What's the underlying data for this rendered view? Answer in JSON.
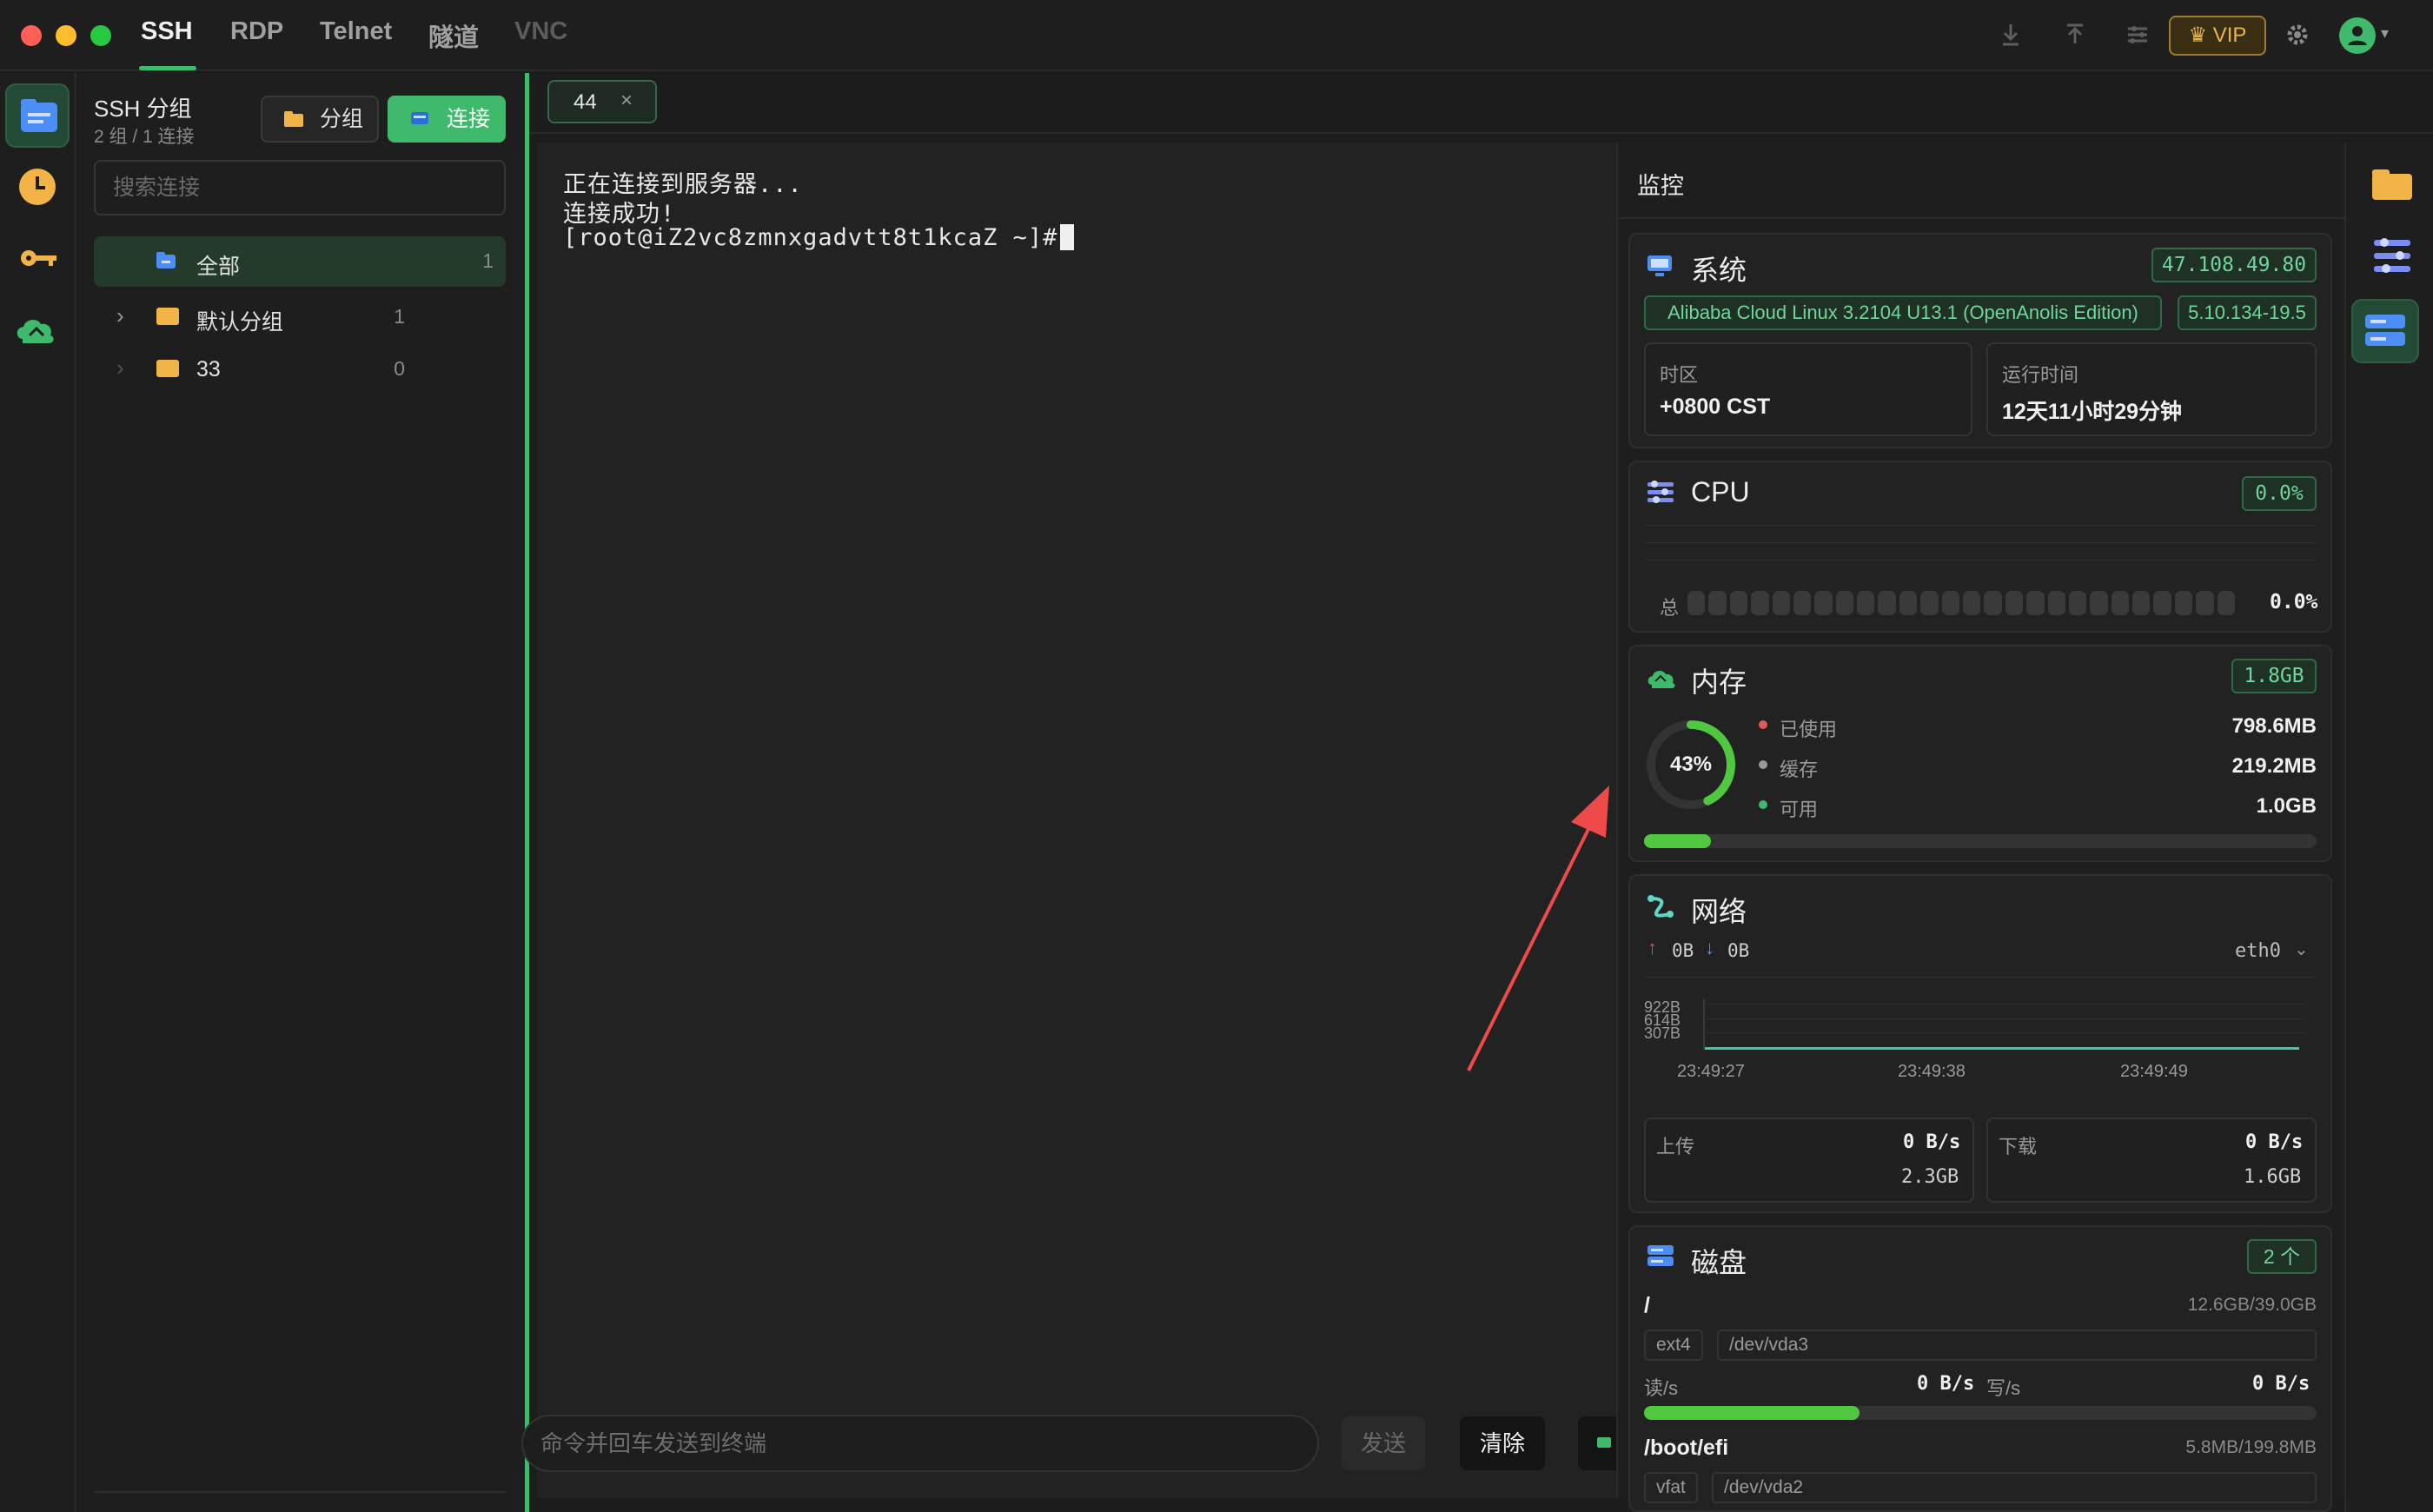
{
  "nav": {
    "tabs": [
      "SSH",
      "RDP",
      "Telnet",
      "隧道",
      "VNC"
    ],
    "vip_label": "VIP"
  },
  "left_panel": {
    "title": "SSH 分组",
    "subtitle": "2 组 / 1 连接",
    "group_button": "分组",
    "connect_button": "连接",
    "search_placeholder": "搜索连接",
    "tree": [
      {
        "label": "全部",
        "count": "1"
      },
      {
        "label": "默认分组",
        "count": "1"
      },
      {
        "label": "33",
        "count": "0"
      }
    ]
  },
  "session_tab": {
    "label": "44",
    "close": "×"
  },
  "terminal": {
    "lines": [
      "正在连接到服务器...",
      "连接成功!",
      "[root@iZ2vc8zmnxgadvtt8t1kcaZ ~]# "
    ],
    "input_placeholder": "命令并回车发送到终端",
    "send": "发送",
    "clear": "清除"
  },
  "monitor": {
    "title": "监控",
    "system": {
      "title": "系统",
      "ip": "47.108.49.80",
      "os": "Alibaba Cloud Linux 3.2104 U13.1 (OpenAnolis Edition)",
      "kernel": "5.10.134-19.5",
      "timezone_label": "时区",
      "timezone": "+0800 CST",
      "uptime_label": "运行时间",
      "uptime": "12天11小时29分钟"
    },
    "cpu": {
      "title": "CPU",
      "badge": "0.0%",
      "total_label": "总",
      "total_value": "0.0%",
      "segments": 26
    },
    "memory": {
      "title": "内存",
      "badge": "1.8GB",
      "percent_label": "43%",
      "percent": 43,
      "used_label": "已使用",
      "used": "798.6MB",
      "cache_label": "缓存",
      "cache": "219.2MB",
      "free_label": "可用",
      "free": "1.0GB",
      "bar_fraction": 0.1,
      "colors": {
        "used": "#e05a5a",
        "cache": "#9a9a9a",
        "free": "#3fb96b"
      }
    },
    "network": {
      "title": "网络",
      "up": "0B",
      "down": "0B",
      "interface": "eth0",
      "y_ticks": [
        "922B",
        "614B",
        "307B"
      ],
      "x_ticks": [
        "23:49:27",
        "23:49:38",
        "23:49:49"
      ],
      "upload_label": "上传",
      "upload_rate": "0 B/s",
      "upload_total": "2.3GB",
      "download_label": "下载",
      "download_rate": "0 B/s",
      "download_total": "1.6GB"
    },
    "disk": {
      "title": "磁盘",
      "badge": "2 个",
      "items": [
        {
          "mount": "/",
          "usage": "12.6GB/39.0GB",
          "fs": "ext4",
          "device": "/dev/vda3",
          "read_label": "读/s",
          "read": "0 B/s",
          "write_label": "写/s",
          "write": "0 B/s",
          "fraction": 0.32
        },
        {
          "mount": "/boot/efi",
          "usage": "5.8MB/199.8MB",
          "fs": "vfat",
          "device": "/dev/vda2"
        }
      ]
    }
  }
}
